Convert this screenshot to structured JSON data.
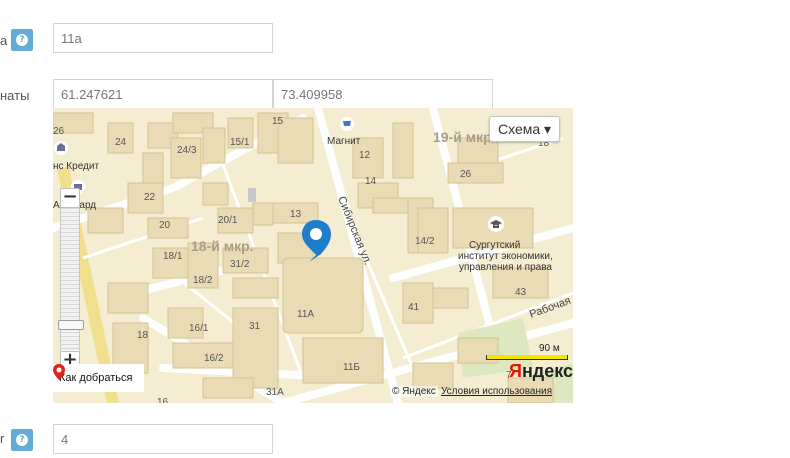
{
  "form": {
    "field1": {
      "label": "а",
      "value": "11а"
    },
    "coords": {
      "label": "наты",
      "lat": "61.247621",
      "lon": "73.409958"
    },
    "field3": {
      "label": "r",
      "value": "4"
    }
  },
  "map": {
    "type_button": "Схема ▾",
    "zoom_in": "+",
    "zoom_out": "−",
    "route_link": "Как добраться",
    "copyright": "© Яндекс",
    "terms_link": "Условия использования",
    "scale_label": "90 м",
    "logo_prefix": "Я",
    "logo_rest": "ндекс",
    "labels": {
      "district_18": "18-й мкр.",
      "district_19": "19-й мкр.",
      "street_sibirskaya": "Сибирская ул.",
      "street_rabochaya": "Рабочая",
      "magnit": "Магнит",
      "bank": "нс Кредит",
      "avangard": "Авангард",
      "institute_1": "Сургутский",
      "institute_2": "институт экономики,",
      "institute_3": "управления и права",
      "h26a": "26",
      "h24": "24",
      "h24_3": "24/3",
      "h15_1": "15/1",
      "h15": "15",
      "h12": "12",
      "h14": "14",
      "h26b": "26",
      "h18": "18",
      "h22": "22",
      "h20": "20",
      "h20_1": "20/1",
      "h13": "13",
      "h18_1": "18/1",
      "h18_2": "18/2",
      "h31_2": "31/2",
      "h14_2": "14/2",
      "h43": "43",
      "h41": "41",
      "h11a": "11А",
      "h16_1": "16/1",
      "h31": "31",
      "h16_2": "16/2",
      "h11b": "11Б",
      "h31a": "31А",
      "h18b": "18",
      "h16": "16",
      "h7": "7"
    }
  },
  "colors": {
    "help": "#63acd6",
    "pin": "#1e7ecb",
    "map_bg": "#f4edd2",
    "building": "#e9dcb4"
  }
}
